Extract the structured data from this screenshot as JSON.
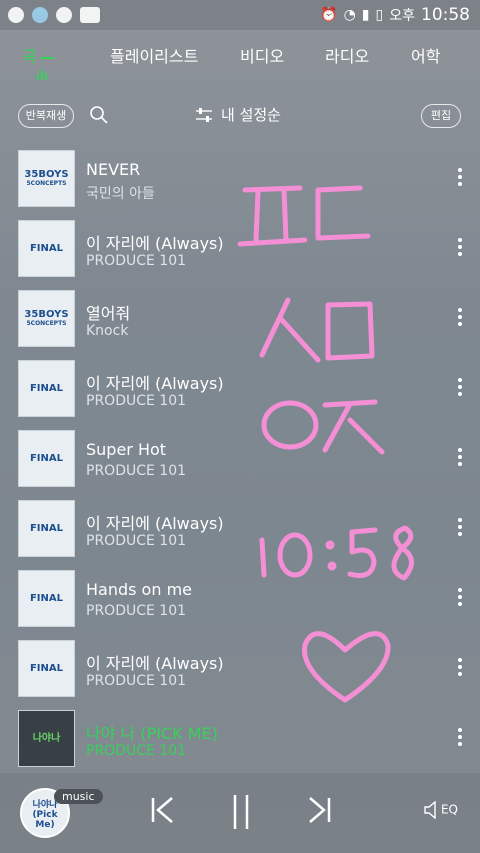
{
  "status_bar": {
    "ampm": "오후",
    "time": "10:58"
  },
  "tabs": [
    {
      "label": "곡",
      "badge": "",
      "active": true
    },
    {
      "label": "플레이리스트",
      "active": false
    },
    {
      "label": "비디오",
      "active": false
    },
    {
      "label": "라디오",
      "active": false
    },
    {
      "label": "어학",
      "active": false
    }
  ],
  "toolbar": {
    "repeat_label": "반복재생",
    "sort_label": "내 설정순",
    "edit_label": "편집"
  },
  "songs": [
    {
      "title": "NEVER",
      "artist": "국민의 아들",
      "art_l1": "35BOYS",
      "art_l2": "5CONCEPTS"
    },
    {
      "title": "이 자리에 (Always)",
      "artist": "PRODUCE 101",
      "art_l1": "FINAL",
      "art_l2": ""
    },
    {
      "title": "열어줘",
      "artist": "Knock",
      "art_l1": "35BOYS",
      "art_l2": "5CONCEPTS"
    },
    {
      "title": "이 자리에 (Always)",
      "artist": "PRODUCE 101",
      "art_l1": "FINAL",
      "art_l2": ""
    },
    {
      "title": "Super Hot",
      "artist": "PRODUCE 101",
      "art_l1": "FINAL",
      "art_l2": ""
    },
    {
      "title": "이 자리에 (Always)",
      "artist": "PRODUCE 101",
      "art_l1": "FINAL",
      "art_l2": ""
    },
    {
      "title": "Hands on me",
      "artist": "PRODUCE 101",
      "art_l1": "FINAL",
      "art_l2": ""
    },
    {
      "title": "이 자리에 (Always)",
      "artist": "PRODUCE 101",
      "art_l1": "FINAL",
      "art_l2": ""
    },
    {
      "title": "나야 나 (PICK ME)",
      "artist": "PRODUCE 101",
      "art_l1": "나야나",
      "art_l2": "",
      "playing": true
    }
  ],
  "player": {
    "badge": "music",
    "art_text": "나야나 (Pick Me)",
    "eq_label": "EQ"
  },
  "handwriting": {
    "lines": [
      "ㅍㄷ",
      "ㅅㅁ",
      "ㅇㅈ",
      "10:58",
      "♡"
    ],
    "color": "#f58fd5"
  },
  "colors": {
    "accent": "#35d35a"
  }
}
